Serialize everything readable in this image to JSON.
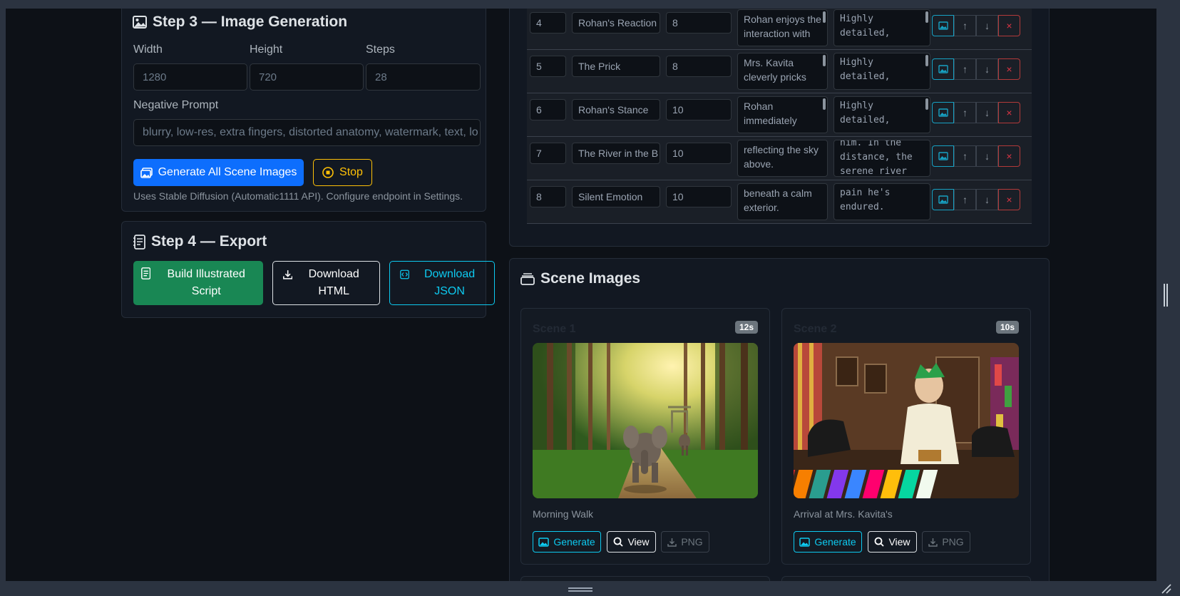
{
  "step3": {
    "title": "Step 3 — Image Generation",
    "width_label": "Width",
    "height_label": "Height",
    "steps_label": "Steps",
    "width_value": "1280",
    "height_value": "720",
    "steps_value": "28",
    "negative_label": "Negative Prompt",
    "negative_value": "blurry, low-res, extra fingers, distorted anatomy, watermark, text, lo",
    "generate_label": "Generate All Scene Images",
    "stop_label": "Stop",
    "note": "Uses Stable Diffusion (Automatic1111 API). Configure endpoint in Settings."
  },
  "step4": {
    "title": "Step 4 — Export",
    "build_label": "Build Illustrated Script",
    "download_html_label": "Download HTML",
    "download_json_label": "Download JSON"
  },
  "scene_table": {
    "rows": [
      {
        "num": "4",
        "title": "Rohan's Reaction",
        "dur": "8",
        "desc": "Rohan enjoys the interaction with",
        "prompt": "Highly detailed,"
      },
      {
        "num": "5",
        "title": "The Prick",
        "dur": "8",
        "desc": "Mrs. Kavita cleverly pricks",
        "prompt": "Highly detailed,"
      },
      {
        "num": "6",
        "title": "Rohan's Stance",
        "dur": "10",
        "desc": "Rohan immediately",
        "prompt": "Highly detailed,"
      },
      {
        "num": "7",
        "title": "The River in the B",
        "dur": "10",
        "desc": "reflecting the sky above.",
        "prompt": "him. In the distance, the serene river"
      },
      {
        "num": "8",
        "title": "Silent Emotion",
        "dur": "10",
        "desc": "beneath a calm exterior.",
        "prompt": "pain he's endured."
      }
    ]
  },
  "scene_images": {
    "title": "Scene Images",
    "cards": [
      {
        "title": "Scene 1",
        "badge": "12s",
        "caption": "Morning Walk",
        "generate": "Generate",
        "view": "View",
        "png": "PNG"
      },
      {
        "title": "Scene 2",
        "badge": "10s",
        "caption": "Arrival at Mrs. Kavita's",
        "generate": "Generate",
        "view": "View",
        "png": "PNG"
      }
    ]
  },
  "colors": {
    "primary": "#0d6efd",
    "warning": "#ffc107",
    "success": "#198754",
    "info": "#0dcaf0",
    "danger": "#dc3545"
  }
}
